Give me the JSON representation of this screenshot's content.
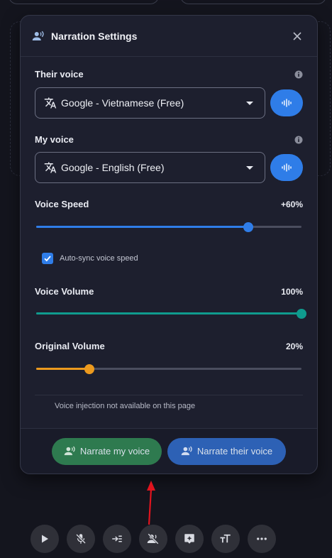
{
  "panel": {
    "title": "Narration Settings",
    "icons": {
      "header": "speaker-person-icon",
      "close": "close-icon"
    }
  },
  "their_voice": {
    "label": "Their voice",
    "selected": "Google - Vietnamese (Free)",
    "icons": {
      "translate": "translate-icon",
      "info": "info-icon",
      "test": "waveform-icon"
    }
  },
  "my_voice": {
    "label": "My voice",
    "selected": "Google - English (Free)",
    "icons": {
      "translate": "translate-icon",
      "info": "info-icon",
      "test": "waveform-icon"
    }
  },
  "voice_speed": {
    "label": "Voice Speed",
    "value_text": "+60%",
    "level": 0.8,
    "color": "#2f7de8"
  },
  "auto_sync": {
    "label": "Auto-sync voice speed",
    "checked": true
  },
  "voice_volume": {
    "label": "Voice Volume",
    "value_text": "100%",
    "level": 1.0,
    "color": "#0f9b8e"
  },
  "original_volume": {
    "label": "Original Volume",
    "value_text": "20%",
    "level": 0.2,
    "color": "#ec9a1e"
  },
  "note": "Voice injection not available on this page",
  "footer": {
    "narrate_mine": "Narrate my voice",
    "narrate_theirs": "Narrate their voice",
    "colors": {
      "mine": "#2e7a4f",
      "theirs": "#2d61b5"
    }
  },
  "toolbar": {
    "icons": [
      "play-icon",
      "mic-off-icon",
      "indent-icon",
      "speaker-off-icon",
      "add-comment-icon",
      "text-size-icon",
      "more-icon"
    ]
  },
  "annotation": {
    "arrow_color": "#e0141e"
  }
}
